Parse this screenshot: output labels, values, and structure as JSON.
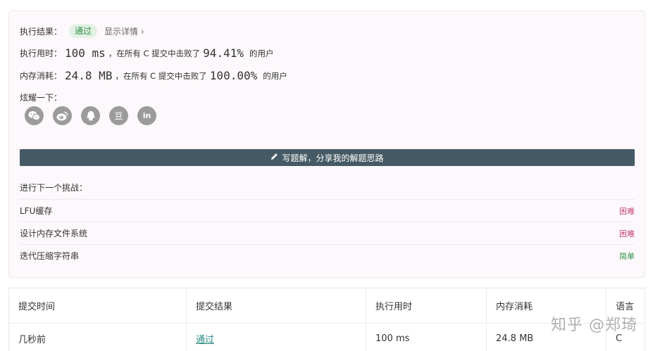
{
  "result": {
    "label": "执行结果：",
    "status": "通过",
    "details_link": "显示详情 ›"
  },
  "runtime": {
    "label": "执行用时：",
    "value": "100 ms",
    "middle": "，在所有 C 提交中击败了",
    "percent": "94.41%",
    "suffix": "的用户"
  },
  "memory": {
    "label": "内存消耗：",
    "value": "24.8 MB",
    "middle": "，在所有 C 提交中击败了",
    "percent": "100.00%",
    "suffix": "的用户"
  },
  "share": {
    "label": "炫耀一下：",
    "icons": [
      "wechat-icon",
      "weibo-icon",
      "qq-icon",
      "douban-icon",
      "linkedin-icon"
    ],
    "douban_glyph": "豆",
    "linkedin_glyph": "in"
  },
  "write_solution": {
    "label": "写题解，分享我的解题思路"
  },
  "next_challenge": {
    "title": "进行下一个挑战：",
    "items": [
      {
        "name": "LFU缓存",
        "difficulty": "困难"
      },
      {
        "name": "设计内存文件系统",
        "difficulty": "困难"
      },
      {
        "name": "迭代压缩字符串",
        "difficulty": "简单"
      }
    ]
  },
  "submissions": {
    "headers": [
      "提交时间",
      "提交结果",
      "执行用时",
      "内存消耗",
      "语言"
    ],
    "rows": [
      [
        "几秒前",
        "通过",
        "100 ms",
        "24.8 MB",
        "C"
      ]
    ]
  },
  "watermark": "知乎 @郑琦",
  "colors": {
    "pass_green": "#2f8f46",
    "hard_pink": "#c2407a",
    "button_slate": "#455a64",
    "link_teal": "#2a8a82"
  }
}
